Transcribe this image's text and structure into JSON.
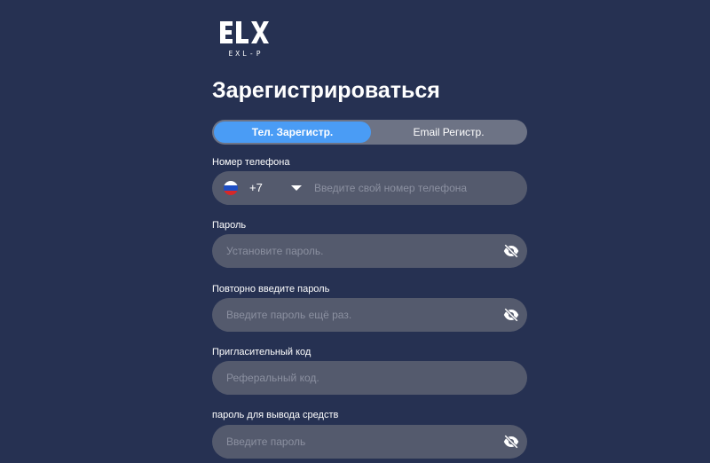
{
  "logo": {
    "mark": "ELX",
    "subtitle": "EXL-P"
  },
  "title": "Зарегистрироваться",
  "tabs": [
    {
      "label": "Тел. Зарегистр.",
      "active": true
    },
    {
      "label": "Email Регистр.",
      "active": false
    }
  ],
  "phone": {
    "label": "Номер телефона",
    "flag_icon": "russia-flag-icon",
    "country_code": "+7",
    "placeholder": "Введите свой номер телефона",
    "value": ""
  },
  "password": {
    "label": "Пароль",
    "placeholder": "Установите пароль.",
    "value": "",
    "icon": "eye-off-icon"
  },
  "confirm_password": {
    "label": "Повторно введите пароль",
    "placeholder": "Введите пароль ещё раз.",
    "value": "",
    "icon": "eye-off-icon"
  },
  "invite_code": {
    "label": "Пригласительный код",
    "placeholder": "Реферальный код.",
    "value": ""
  },
  "withdraw_password": {
    "label": "пароль для вывода средств",
    "placeholder": "Введите пароль",
    "value": "",
    "icon": "eye-off-icon"
  },
  "colors": {
    "background": "#263152",
    "input_background": "#545a6d",
    "tab_track": "#6d7385",
    "accent": "#4a9cf5"
  }
}
